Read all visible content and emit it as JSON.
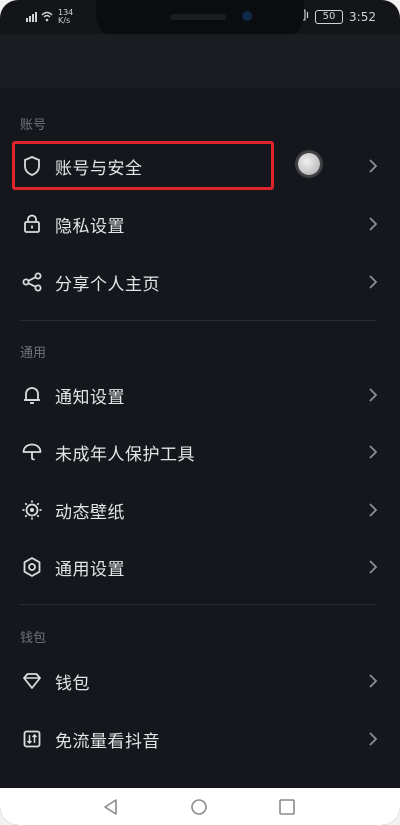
{
  "status_bar": {
    "signal_text": "⁴ᴳ",
    "net_speed_value": "134",
    "net_speed_unit": "K/s",
    "battery": "50",
    "time": "3:52"
  },
  "sections": [
    {
      "header": "账号",
      "items": [
        {
          "label": "账号与安全",
          "icon": "shield-icon"
        },
        {
          "label": "隐私设置",
          "icon": "lock-icon"
        },
        {
          "label": "分享个人主页",
          "icon": "share-icon"
        }
      ]
    },
    {
      "header": "通用",
      "items": [
        {
          "label": "通知设置",
          "icon": "bell-icon"
        },
        {
          "label": "未成年人保护工具",
          "icon": "umbrella-icon"
        },
        {
          "label": "动态壁纸",
          "icon": "wallpaper-icon"
        },
        {
          "label": "通用设置",
          "icon": "hexagon-settings-icon"
        }
      ]
    },
    {
      "header": "钱包",
      "items": [
        {
          "label": "钱包",
          "icon": "diamond-icon"
        },
        {
          "label": "免流量看抖音",
          "icon": "data-plan-icon"
        }
      ]
    }
  ],
  "colors": {
    "background": "#15171c",
    "highlight_box": "#e0242b",
    "text": "#e3e5e8",
    "section_header": "#6f737a"
  }
}
